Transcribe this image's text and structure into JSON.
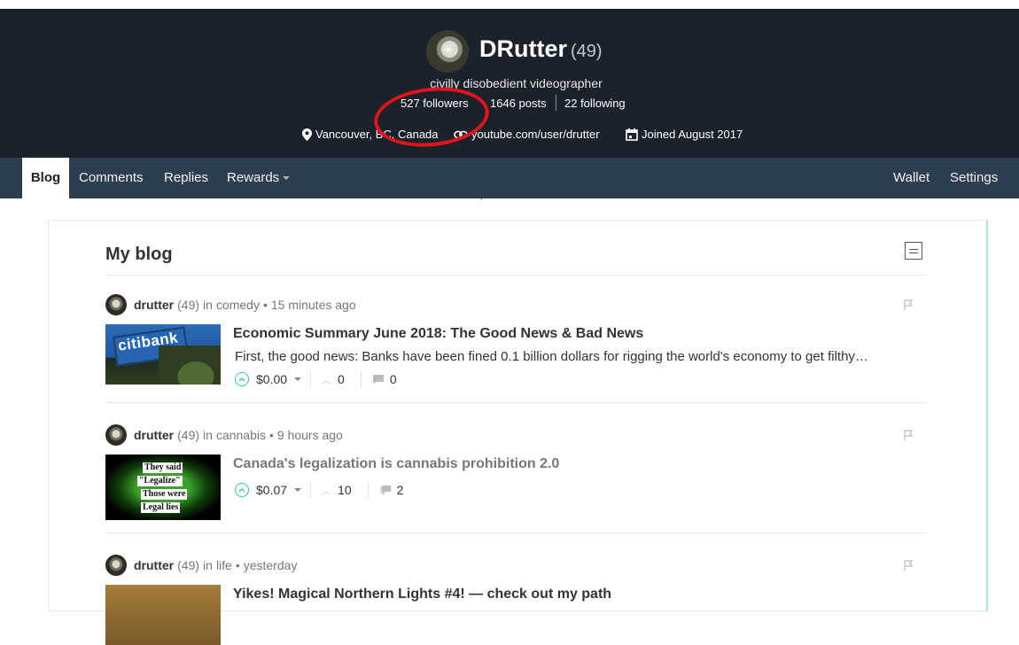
{
  "profile": {
    "name": "DRutter",
    "reputation": "(49)",
    "about": "civilly disobedient videographer",
    "followers": "527 followers",
    "posts": "1646 posts",
    "following": "22 following",
    "location": "Vancouver, BC, Canada",
    "website": "youtube.com/user/drutter",
    "joined": "Joined August 2017"
  },
  "nav": {
    "tabs": [
      "Blog",
      "Comments",
      "Replies",
      "Rewards"
    ],
    "right": [
      "Wallet",
      "Settings"
    ]
  },
  "blog": {
    "title": "My blog",
    "posts": [
      {
        "author": "drutter",
        "rep": "(49)",
        "in": "in",
        "category": "comedy",
        "time": "15 minutes ago",
        "title": "Economic Summary June 2018: The Good News & Bad News",
        "excerpt": "First, the good news: Banks have been fined 0.1 billion dollars for rigging the world's economy to get filthy…",
        "payout": "$0.00",
        "votes": "0",
        "comments": "0",
        "thumb_text": "citibank"
      },
      {
        "author": "drutter",
        "rep": "(49)",
        "in": "in",
        "category": "cannabis",
        "time": "9 hours ago",
        "title": "Canada's legalization is cannabis prohibition 2.0",
        "excerpt": "",
        "payout": "$0.07",
        "votes": "10",
        "comments": "2",
        "thumb_lines": [
          "They said",
          "\"Legalize\"",
          "Those were",
          "Legal lies"
        ]
      },
      {
        "author": "drutter",
        "rep": "(49)",
        "in": "in",
        "category": "life",
        "time": "yesterday",
        "title": "Yikes! Magical Northern Lights #4! — check out my path"
      }
    ]
  },
  "colors": {
    "header_bg": "#1c222b",
    "nav_bg": "#2c3e4f",
    "accent": "#33c8a2",
    "annotation": "#e0141a"
  }
}
